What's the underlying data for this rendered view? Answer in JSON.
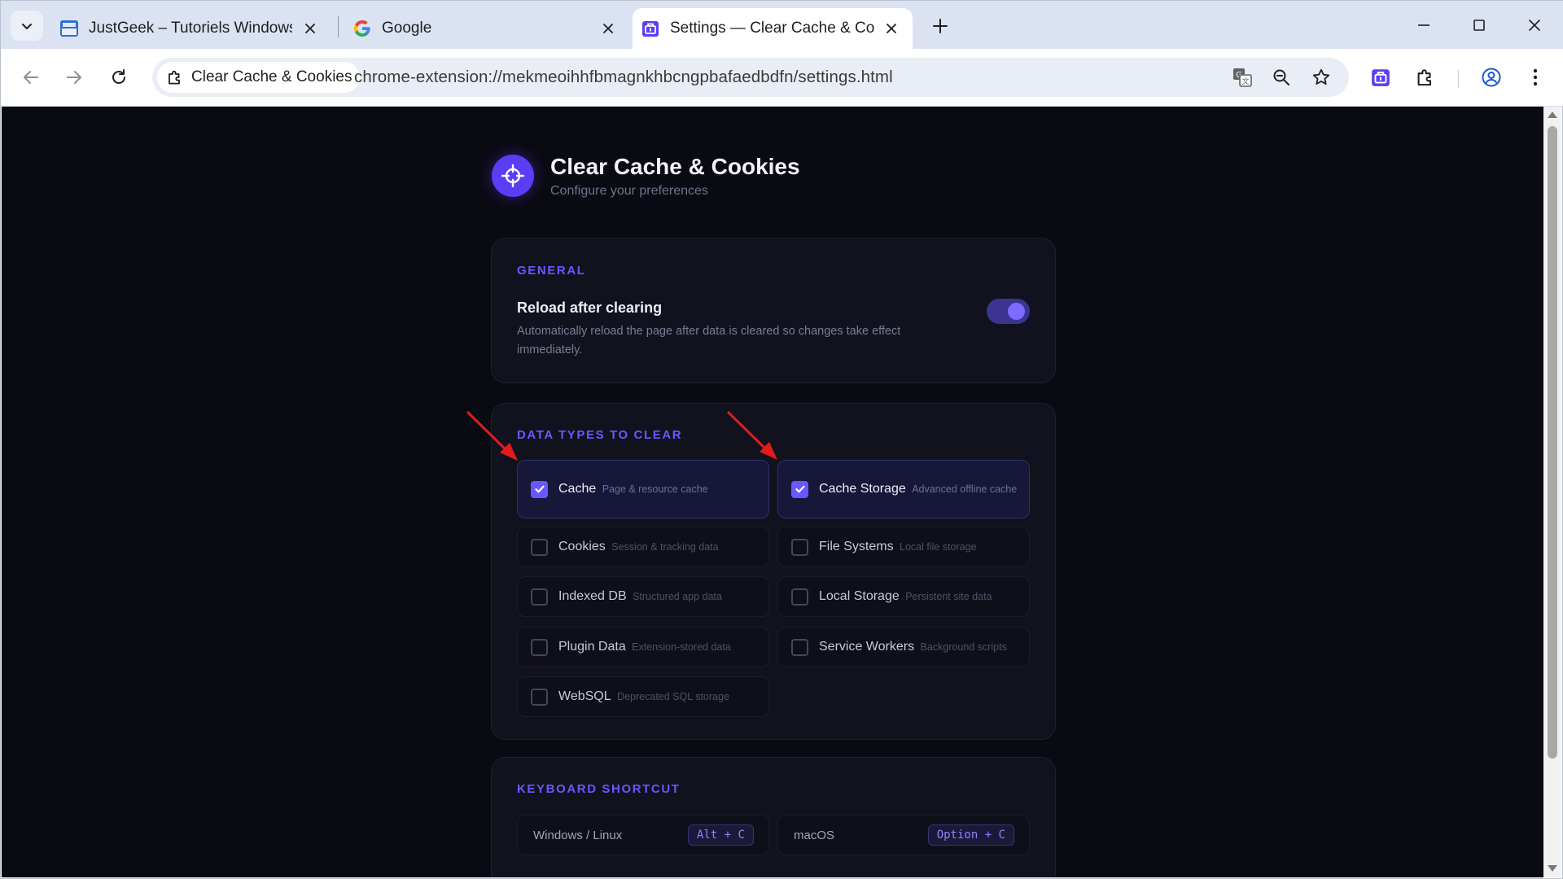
{
  "browser": {
    "tabs": [
      {
        "title": "JustGeek – Tutoriels Windows, Li",
        "favicon": "justgeek-favicon"
      },
      {
        "title": "Google",
        "favicon": "google-favicon"
      },
      {
        "title": "Settings — Clear Cache & Cookies",
        "favicon": "extension-favicon",
        "active": true
      }
    ],
    "site_chip": "Clear Cache & Cookies",
    "url": "chrome-extension://mekmeoihhfbmagnkhbcngpbafaedbdfn/settings.html"
  },
  "app": {
    "title": "Clear Cache & Cookies",
    "subtitle": "Configure your preferences",
    "accent": "#6a57ff"
  },
  "general": {
    "section_label": "GENERAL",
    "reload": {
      "title": "Reload after clearing",
      "description": "Automatically reload the page after data is cleared so changes take effect immediately.",
      "enabled": true
    }
  },
  "data_types": {
    "section_label": "DATA TYPES TO CLEAR",
    "items": [
      {
        "name": "Cache",
        "hint": "Page & resource cache",
        "checked": true
      },
      {
        "name": "Cache Storage",
        "hint": "Advanced offline cache",
        "checked": true
      },
      {
        "name": "Cookies",
        "hint": "Session & tracking data",
        "checked": false
      },
      {
        "name": "File Systems",
        "hint": "Local file storage",
        "checked": false
      },
      {
        "name": "Indexed DB",
        "hint": "Structured app data",
        "checked": false
      },
      {
        "name": "Local Storage",
        "hint": "Persistent site data",
        "checked": false
      },
      {
        "name": "Plugin Data",
        "hint": "Extension-stored data",
        "checked": false
      },
      {
        "name": "Service Workers",
        "hint": "Background scripts",
        "checked": false
      },
      {
        "name": "WebSQL",
        "hint": "Deprecated SQL storage",
        "checked": false
      }
    ]
  },
  "shortcut": {
    "section_label": "KEYBOARD SHORTCUT",
    "windows_label": "Windows / Linux",
    "windows_keys": "Alt + C",
    "mac_label": "macOS",
    "mac_keys": "Option + C"
  }
}
